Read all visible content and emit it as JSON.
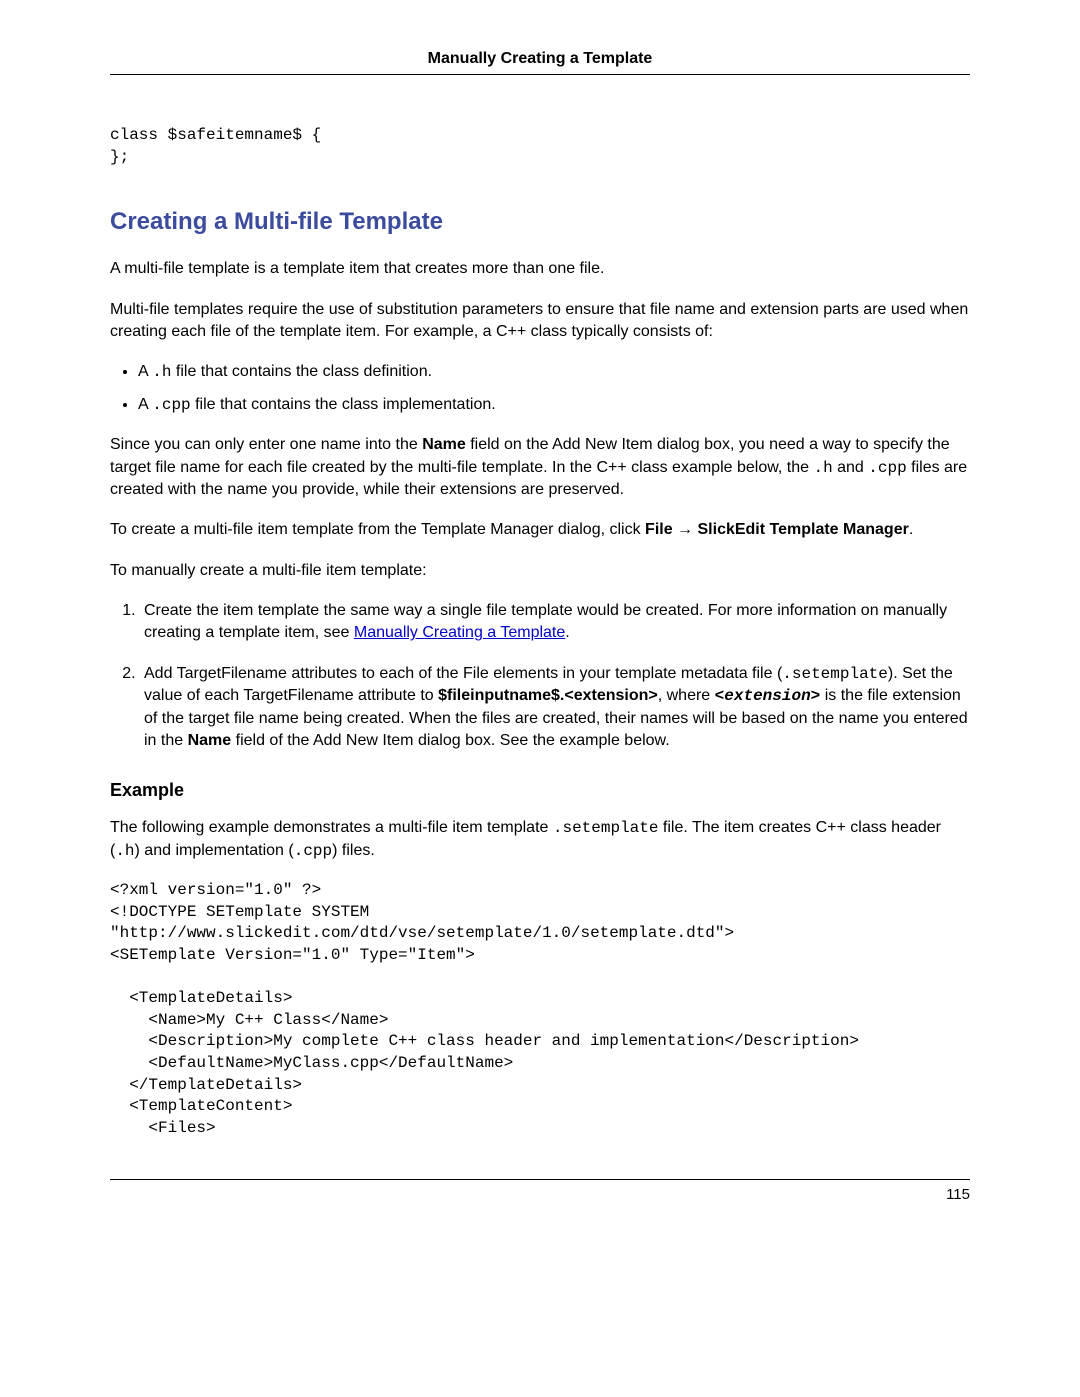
{
  "header": "Manually Creating a Template",
  "code1": "class $safeitemname$ {\n};",
  "h2": "Creating a Multi-file Template",
  "p1": "A multi-file template is a template item that creates more than one file.",
  "p2": "Multi-file templates require the use of substitution parameters to ensure that file name and extension parts are used when creating each file of the template item. For example, a C++ class typically consists of:",
  "bullets": {
    "b1a": "A ",
    "b1code": ".h",
    "b1b": " file that contains the class definition.",
    "b2a": "A ",
    "b2code": ".cpp",
    "b2b": " file that contains the class implementation."
  },
  "p3": {
    "a": "Since you can only enter one name into the ",
    "b": "Name",
    "c": " field on the Add New Item dialog box, you need a way to specify the target file name for each file created by the multi-file template. In the C++ class example below, the ",
    "d": ".h",
    "e": " and ",
    "f": ".cpp",
    "g": " files are created with the name you provide, while their extensions are preserved."
  },
  "p4": {
    "a": "To create a multi-file item template from the Template Manager dialog, click  ",
    "b": "File",
    "arrow": " → ",
    "c": "SlickEdit Template Manager",
    "d": "."
  },
  "p5": "To manually create a multi-file item template:",
  "ol": {
    "i1": {
      "a": "Create the item template the same way a single file template would be created. For more information on manually creating a template item, see ",
      "link": "Manually Creating a Template",
      "b": "."
    },
    "i2": {
      "a": "Add TargetFilename attributes to each of the File elements in your template metadata file (",
      "code1": ".setemplate",
      "b": "). Set the value of each TargetFilename attribute to  ",
      "bold1": "$fileinputname$.<extension>",
      "c": ", where ",
      "bold2": "<extension>",
      "d": " is the file extension of the target file name being created. When the files are created, their names will be based on the name you entered in the ",
      "bold3": "Name",
      "e": " field of the Add New Item dialog box. See the example below."
    }
  },
  "h3": "Example",
  "p6": {
    "a": "The following example demonstrates a multi-file item template ",
    "code1": ".setemplate",
    "b": " file. The item creates C++ class header (",
    "code2": ".h",
    "c": ") and implementation (",
    "code3": ".cpp",
    "d": ") files."
  },
  "code2": "<?xml version=\"1.0\" ?>\n<!DOCTYPE SETemplate SYSTEM\n\"http://www.slickedit.com/dtd/vse/setemplate/1.0/setemplate.dtd\">\n<SETemplate Version=\"1.0\" Type=\"Item\">\n\n  <TemplateDetails>\n    <Name>My C++ Class</Name>\n    <Description>My complete C++ class header and implementation</Description>\n    <DefaultName>MyClass.cpp</DefaultName>\n  </TemplateDetails>\n  <TemplateContent>\n    <Files>",
  "pagenum": "115"
}
